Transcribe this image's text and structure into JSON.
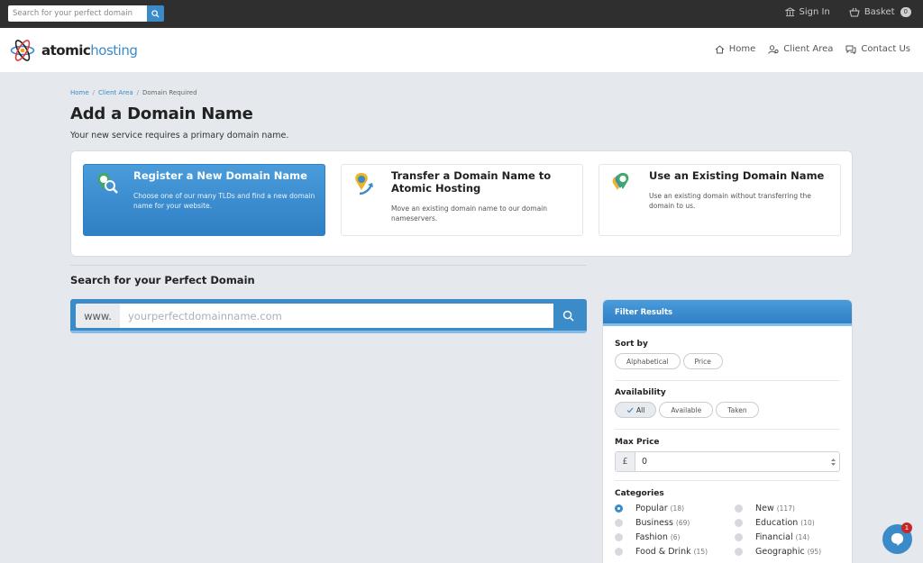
{
  "topbar": {
    "search_placeholder": "Search for your perfect domain",
    "sign_in": "Sign In",
    "basket": "Basket",
    "basket_count": "0"
  },
  "brand": {
    "name_bold": "atomic",
    "name_light": "hosting"
  },
  "nav": {
    "home": "Home",
    "client_area": "Client Area",
    "contact": "Contact Us"
  },
  "breadcrumb": [
    "Home",
    "Client Area",
    "Domain Required"
  ],
  "page": {
    "title": "Add a Domain Name",
    "subtitle": "Your new service requires a primary domain name."
  },
  "options": [
    {
      "title": "Register a New Domain Name",
      "desc": "Choose one of our many TLDs and find a new domain name for your website.",
      "active": true
    },
    {
      "title": "Transfer a Domain Name to Atomic Hosting",
      "desc": "Move an existing domain name to our domain nameservers.",
      "active": false
    },
    {
      "title": "Use an Existing Domain Name",
      "desc": "Use an existing domain without transferring the domain to us.",
      "active": false
    }
  ],
  "search": {
    "section_title": "Search for your Perfect Domain",
    "prefix": "www.",
    "placeholder": "yourperfectdomainname.com"
  },
  "filter": {
    "title": "Filter Results",
    "sort_label": "Sort by",
    "sort_options": [
      "Alphabetical",
      "Price"
    ],
    "availability_label": "Availability",
    "availability_options": [
      "All",
      "Available",
      "Taken"
    ],
    "availability_selected": "All",
    "max_price_label": "Max Price",
    "currency": "£",
    "max_price": "0",
    "categories_label": "Categories",
    "categories": [
      {
        "name": "Popular",
        "count": "(18)",
        "selected": true
      },
      {
        "name": "New",
        "count": "(117)",
        "selected": false
      },
      {
        "name": "Business",
        "count": "(69)",
        "selected": false
      },
      {
        "name": "Education",
        "count": "(10)",
        "selected": false
      },
      {
        "name": "Fashion",
        "count": "(6)",
        "selected": false
      },
      {
        "name": "Financial",
        "count": "(14)",
        "selected": false
      },
      {
        "name": "Food & Drink",
        "count": "(15)",
        "selected": false
      },
      {
        "name": "Geographic",
        "count": "(95)",
        "selected": false
      }
    ]
  },
  "chat": {
    "unread": "1"
  },
  "colors": {
    "accent": "#3a8bc8",
    "topbar": "#2f2f2f",
    "background": "#e5e8ed"
  }
}
